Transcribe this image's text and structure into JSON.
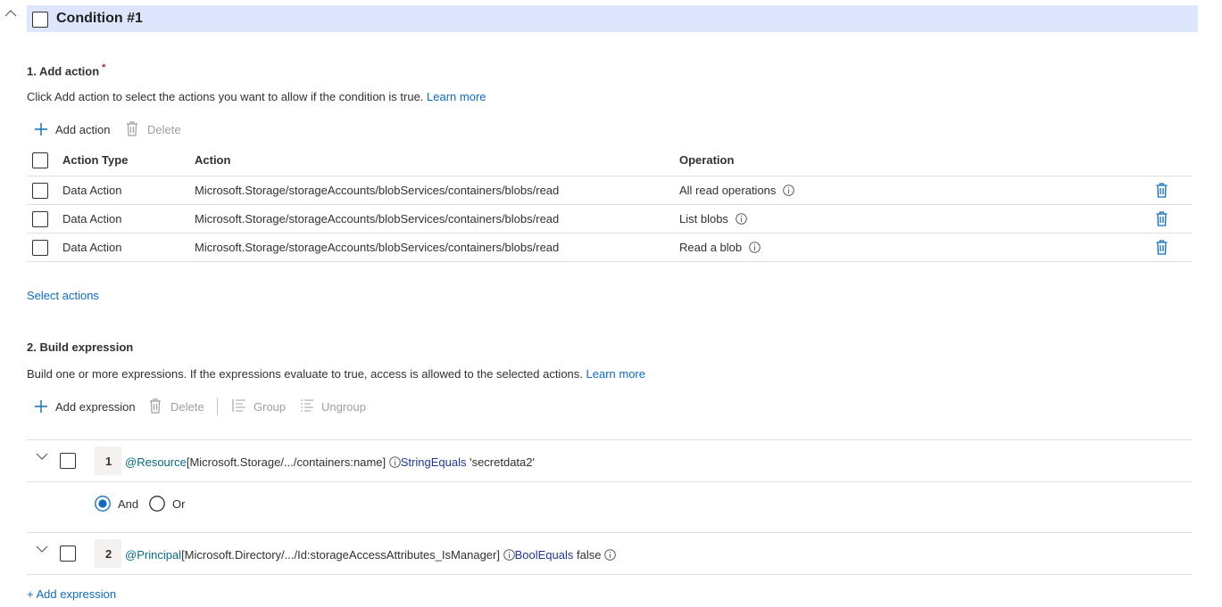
{
  "condition": {
    "title": "Condition #1"
  },
  "section1": {
    "title": "1. Add action",
    "required_mark": "*",
    "description": "Click Add action to select the actions you want to allow if the condition is true.",
    "learn_more": "Learn more",
    "toolbar": {
      "add_label": "Add action",
      "delete_label": "Delete"
    },
    "table": {
      "headers": [
        "Action Type",
        "Action",
        "Operation"
      ],
      "rows": [
        {
          "type": "Data Action",
          "action": "Microsoft.Storage/storageAccounts/blobServices/containers/blobs/read",
          "operation": "All read operations"
        },
        {
          "type": "Data Action",
          "action": "Microsoft.Storage/storageAccounts/blobServices/containers/blobs/read",
          "operation": "List blobs"
        },
        {
          "type": "Data Action",
          "action": "Microsoft.Storage/storageAccounts/blobServices/containers/blobs/read",
          "operation": "Read a blob"
        }
      ]
    },
    "select_actions": "Select actions"
  },
  "section2": {
    "title": "2. Build expression",
    "description": "Build one or more expressions. If the expressions evaluate to true, access is allowed to the selected actions.",
    "learn_more": "Learn more",
    "toolbar": {
      "add_label": "Add expression",
      "delete_label": "Delete",
      "group_label": "Group",
      "ungroup_label": "Ungroup"
    },
    "expressions": [
      {
        "number": "1",
        "source": "@Resource",
        "attribute": "[Microsoft.Storage/.../containers:name]",
        "operator": "StringEquals",
        "value": "'secretdata2'"
      },
      {
        "number": "2",
        "source": "@Principal",
        "attribute": "[Microsoft.Directory/.../Id:storageAccessAttributes_IsManager]",
        "operator": "BoolEquals",
        "value": "false"
      }
    ],
    "logic": {
      "and_label": "And",
      "or_label": "Or",
      "selected": "And"
    },
    "add_expression_link": "+ Add expression"
  },
  "colors": {
    "accent": "#0f6cbd",
    "header_bg": "#dde6fc",
    "disabled": "#a19f9d",
    "border": "#e1dfdd"
  }
}
